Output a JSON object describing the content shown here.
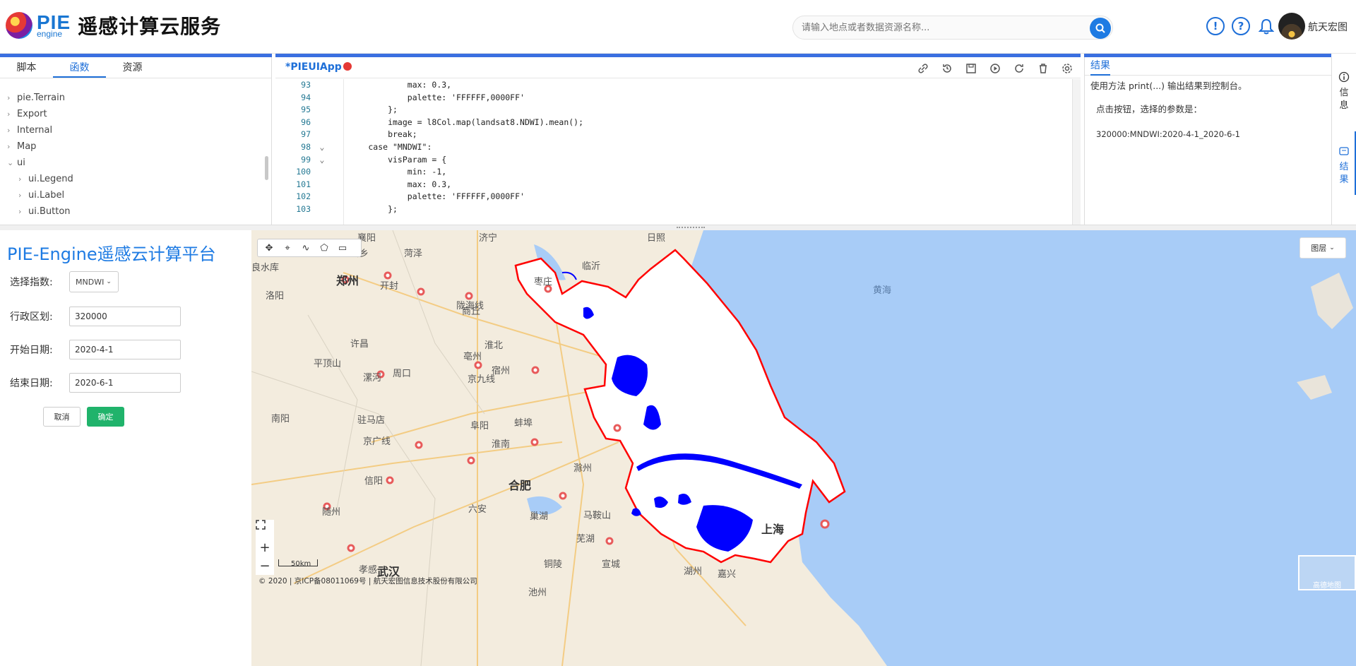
{
  "header": {
    "logo_pie": "PIE",
    "logo_engine": "engine",
    "app_title": "遥感计算云服务",
    "search_placeholder": "请输入地点或者数据资源名称...",
    "username": "航天宏图"
  },
  "left_tabs": [
    "脚本",
    "函数",
    "资源"
  ],
  "tree": [
    {
      "label": "pie.Terrain",
      "arrow": "›",
      "level": 0
    },
    {
      "label": "Export",
      "arrow": "›",
      "level": 0
    },
    {
      "label": "Internal",
      "arrow": "›",
      "level": 0
    },
    {
      "label": "Map",
      "arrow": "›",
      "level": 0
    },
    {
      "label": "ui",
      "arrow": "⌄",
      "level": 0
    },
    {
      "label": "ui.Legend",
      "arrow": "›",
      "level": 1
    },
    {
      "label": "ui.Label",
      "arrow": "›",
      "level": 1
    },
    {
      "label": "ui.Button",
      "arrow": "›",
      "level": 1
    }
  ],
  "editor": {
    "tab_title": "*PIEUIApp",
    "lines": [
      {
        "n": "93",
        "fold": "",
        "code": "                max: 0.3,"
      },
      {
        "n": "94",
        "fold": "",
        "code": "                palette: 'FFFFFF,0000FF'"
      },
      {
        "n": "95",
        "fold": "",
        "code": "            };"
      },
      {
        "n": "96",
        "fold": "",
        "code": "            image = l8Col.map(landsat8.NDWI).mean();"
      },
      {
        "n": "97",
        "fold": "",
        "code": "            break;"
      },
      {
        "n": "98",
        "fold": "⌄",
        "code": "        case \"MNDWI\":"
      },
      {
        "n": "99",
        "fold": "⌄",
        "code": "            visParam = {"
      },
      {
        "n": "100",
        "fold": "",
        "code": "                min: -1,"
      },
      {
        "n": "101",
        "fold": "",
        "code": "                max: 0.3,"
      },
      {
        "n": "102",
        "fold": "",
        "code": "                palette: 'FFFFFF,0000FF'"
      },
      {
        "n": "103",
        "fold": "",
        "code": "            };"
      }
    ]
  },
  "results": {
    "tab": "结果",
    "hint": "使用方法 print(...) 输出结果到控制台。",
    "line1": "点击按钮，选择的参数是：",
    "line2": "320000:MNDWI:2020-4-1_2020-6-1"
  },
  "side_rail": {
    "info": "信息",
    "result": "结果"
  },
  "form": {
    "title": "PIE-Engine遥感云计算平台",
    "index_label": "选择指数:",
    "index_value": "MNDWI",
    "region_label": "行政区划:",
    "region_value": "320000",
    "start_label": "开始日期:",
    "start_value": "2020-4-1",
    "end_label": "结束日期:",
    "end_value": "2020-6-1",
    "cancel": "取消",
    "ok": "确定"
  },
  "map": {
    "layers_label": "图层",
    "scale_text": "50km",
    "copyright": "© 2020 | 京ICP备08011069号 | 航天宏图信息技术股份有限公司",
    "basemap_label": "高德地图",
    "labels": [
      {
        "text": "郑州",
        "big": true
      },
      {
        "text": "济宁"
      },
      {
        "text": "日照"
      },
      {
        "text": "菏泽"
      },
      {
        "text": "新乡"
      },
      {
        "text": "临沂"
      },
      {
        "text": "枣庄"
      },
      {
        "text": "开封"
      },
      {
        "text": "洛阳"
      },
      {
        "text": "商丘"
      },
      {
        "text": "许昌"
      },
      {
        "text": "淮北"
      },
      {
        "text": "亳州"
      },
      {
        "text": "平顶山"
      },
      {
        "text": "漯河"
      },
      {
        "text": "周口"
      },
      {
        "text": "宿州"
      },
      {
        "text": "南阳"
      },
      {
        "text": "驻马店"
      },
      {
        "text": "阜阳"
      },
      {
        "text": "蚌埠"
      },
      {
        "text": "淮南"
      },
      {
        "text": "滁州"
      },
      {
        "text": "信阳"
      },
      {
        "text": "合肥",
        "big": true
      },
      {
        "text": "六安"
      },
      {
        "text": "巢湖"
      },
      {
        "text": "马鞍山"
      },
      {
        "text": "随州"
      },
      {
        "text": "芜湖"
      },
      {
        "text": "武汉",
        "big": true
      },
      {
        "text": "孝感"
      },
      {
        "text": "铜陵"
      },
      {
        "text": "宣城"
      },
      {
        "text": "湖州"
      },
      {
        "text": "嘉兴"
      },
      {
        "text": "上海",
        "big": true
      },
      {
        "text": "黄海",
        "sea": true
      },
      {
        "text": "池州"
      },
      {
        "text": "襄阳"
      },
      {
        "text": "陇海线"
      },
      {
        "text": "京九线"
      },
      {
        "text": "京广线"
      },
      {
        "text": "良水库"
      }
    ]
  },
  "colors": {
    "accent": "#1e7be3",
    "ok_button": "#20b36b",
    "boundary": "#ff0000",
    "water": "#0000ff",
    "sea": "#a8ccf7"
  }
}
